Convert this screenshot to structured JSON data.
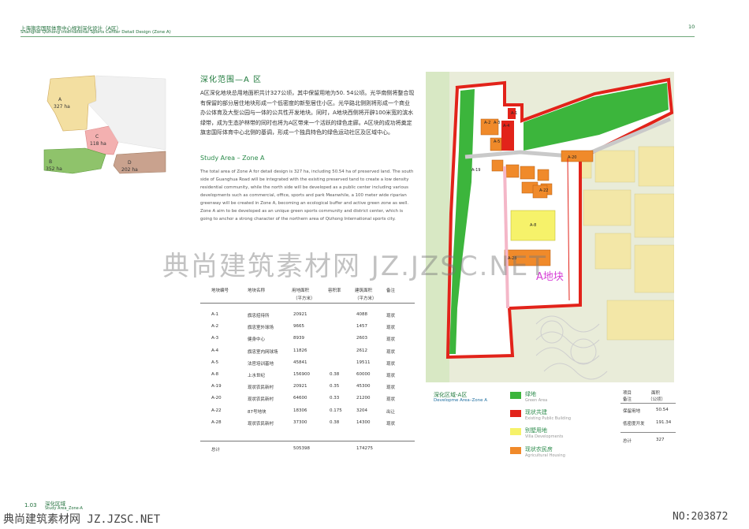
{
  "header": {
    "title_cn": "上海旗忠国际体育中心规划深化设计（A区）",
    "title_en": "Shanghai Qizhong International Sports Center Detail Design (Zone A)",
    "page": "10"
  },
  "minimap": {
    "zones": [
      {
        "letter": "A",
        "area": "327 ha",
        "color": "#f3dfa1"
      },
      {
        "letter": "C",
        "area": "118 ha",
        "color": "#f3b0b0"
      },
      {
        "letter": "B",
        "area": "352 ha",
        "color": "#8fc36b"
      },
      {
        "letter": "D",
        "area": "202 ha",
        "color": "#c9a28e"
      }
    ]
  },
  "section": {
    "title_cn": "深化范围—A 区",
    "para_cn": "A区深化地块总用地面积共计327公顷，其中保留用地为50. 54公顷。光华南侧将整合现有保留的部分居住地块形成一个低密度的新型居住小区。光华路北侧则将形成一个商业办公体育及大型公园与一体的公共性开发地块。同时，A地块西侧将开辟100米宽的滨水绿带，成为生态护林带的同时也将为A区带来一个活跃的绿色走廊。A区块的成功将奠定旗忠国际体育中心北侧的基调，形成一个独具特色的绿色运动社区及区域中心。",
    "title_en": "Study Area – Zone A",
    "para_en": "The total area of Zone A for detail design is 327 ha, including 50.54 ha of preserved land. The south side of Guanghua Road will be integrated with the existing preserved tand to create a low density residential community, while the north side will be developed as a public center including various developments such as commercial, office, sports and park Meanwhile, a 100 meter wide riparian greenway will be created in Zone A, becoming an ecological buffer and active green zone as well. Zone A aim to be developed as an unique green sports community and district center, which is going to anchor a strong character of the northern area of Qizhong International sports city."
  },
  "table": {
    "headers": [
      "地块编号",
      "地块名称",
      "用地面积（平方米）",
      "容积率",
      "建筑面积（平方米）",
      "备注"
    ],
    "header_unit": "（平方米）",
    "rows": [
      [
        "A-1",
        "旗忠招待所",
        "20921",
        "",
        "4088",
        "现状"
      ],
      [
        "A-2",
        "旗忠室外球场",
        "9665",
        "",
        "1457",
        "现状"
      ],
      [
        "A-3",
        "健身中心",
        "8939",
        "",
        "2603",
        "现状"
      ],
      [
        "A-4",
        "旗忠室内网球场",
        "11826",
        "",
        "2612",
        "现状"
      ],
      [
        "A-5",
        "法官培训基地",
        "45841",
        "",
        "19511",
        "现状"
      ],
      [
        "A-8",
        "上水世纪",
        "156900",
        "0.38",
        "60000",
        "现状"
      ],
      [
        "A-19",
        "现状农民新村",
        "20921",
        "0.35",
        "45300",
        "现状"
      ],
      [
        "A-20",
        "现状农民新村",
        "64600",
        "0.33",
        "21200",
        "现状"
      ],
      [
        "A-22",
        "87号地块",
        "18306",
        "0.175",
        "3204",
        "出让"
      ],
      [
        "A-28",
        "现状农民新村",
        "37300",
        "0.38",
        "14300",
        "现状"
      ]
    ],
    "total_label": "总计",
    "total_area": "505398",
    "total_building": "174275"
  },
  "map": {
    "label": "A地块",
    "block_labels": [
      "A-1",
      "A-2",
      "A-3",
      "A-4",
      "A-5",
      "A-8",
      "A-19",
      "A-20",
      "A-22",
      "A-28"
    ],
    "colors": {
      "boundary": "#e2231a",
      "green": "#3cb53c",
      "red": "#e2231a",
      "yellow": "#f6f26a",
      "orange": "#f08a2a",
      "label": "#d63fd6"
    }
  },
  "legend": {
    "title_cn": "深化区域-A区",
    "title_en": "Developme Area–Zone A",
    "items": [
      {
        "cn": "绿地",
        "en": "Green Area",
        "color": "#3cb53c"
      },
      {
        "cn": "现状共建",
        "en": "Existing Public Building",
        "color": "#e2231a"
      },
      {
        "cn": "别墅用地",
        "en": "Villa Developments",
        "color": "#f6f26a"
      },
      {
        "cn": "现状农民房",
        "en": "Agricultural Housing",
        "color": "#f08a2a"
      }
    ]
  },
  "summary": {
    "col1": "项目",
    "col1b": "备注",
    "col2": "面积",
    "col2b": "（公顷）",
    "rows": [
      [
        "保留用地",
        "50.54"
      ],
      [
        "低密度开发",
        "191.34"
      ]
    ],
    "total_label": "总计",
    "total_value": "327"
  },
  "footer": {
    "num": "1.03",
    "title_cn": "深化区域",
    "title_en": "Study Area_Zone-A"
  },
  "watermark": {
    "center": "典尚建筑素材网 JZ.JZSC.NET",
    "bottom": "典尚建筑素材网 JZ.JZSC.NET",
    "no": "NO:203872"
  }
}
